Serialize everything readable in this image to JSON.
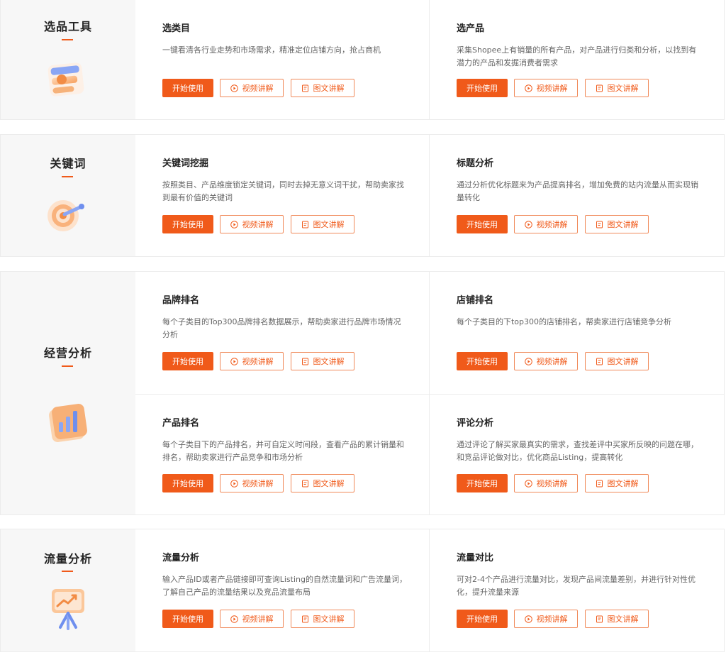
{
  "colors": {
    "accent": "#f05a1a",
    "panel": "#f7f7f7",
    "border": "#ececec"
  },
  "sections": [
    {
      "title": "选品工具",
      "icon": "product-selection-icon",
      "tools": [
        {
          "title": "选类目",
          "desc": "一键看清各行业走势和市场需求，精准定位店铺方向，抢占商机",
          "start": "开始使用",
          "video": "视频讲解",
          "doc": "图文讲解"
        },
        {
          "title": "选产品",
          "desc": "采集Shopee上有销量的所有产品，对产品进行归类和分析，以找到有潜力的产品和发掘消费者需求",
          "start": "开始使用",
          "video": "视频讲解",
          "doc": "图文讲解"
        }
      ]
    },
    {
      "title": "关键词",
      "icon": "keyword-target-icon",
      "tools": [
        {
          "title": "关键词挖掘",
          "desc": "按照类目、产品维度锁定关键词，同时去掉无意义词干扰，帮助卖家找到最有价值的关键词",
          "start": "开始使用",
          "video": "视频讲解",
          "doc": "图文讲解"
        },
        {
          "title": "标题分析",
          "desc": "通过分析优化标题来为产品提高排名，增加免费的站内流量从而实现销量转化",
          "start": "开始使用",
          "video": "视频讲解",
          "doc": "图文讲解"
        }
      ]
    },
    {
      "title": "经营分析",
      "icon": "bar-chart-icon",
      "tools": [
        {
          "title": "品牌排名",
          "desc": "每个子类目的Top300品牌排名数据展示，帮助卖家进行品牌市场情况分析",
          "start": "开始使用",
          "video": "视频讲解",
          "doc": "图文讲解"
        },
        {
          "title": "店铺排名",
          "desc": "每个子类目的下top300的店铺排名，帮卖家进行店铺竞争分析",
          "start": "开始使用",
          "video": "视频讲解",
          "doc": "图文讲解"
        },
        {
          "title": "产品排名",
          "desc": "每个子类目下的产品排名，并可自定义时间段，查看产品的累计销量和排名，帮助卖家进行产品竞争和市场分析",
          "start": "开始使用",
          "video": "视频讲解",
          "doc": "图文讲解"
        },
        {
          "title": "评论分析",
          "desc": "通过评论了解买家最真实的需求，查找差评中买家所反映的问题在哪，和竞品评论做对比，优化商品Listing，提高转化",
          "start": "开始使用",
          "video": "视频讲解",
          "doc": "图文讲解"
        }
      ]
    },
    {
      "title": "流量分析",
      "icon": "traffic-board-icon",
      "tools": [
        {
          "title": "流量分析",
          "desc": "输入产品ID或者产品链接即可查询Listing的自然流量词和广告流量词，了解自己产品的流量结果以及竞品流量布局",
          "start": "开始使用",
          "video": "视频讲解",
          "doc": "图文讲解"
        },
        {
          "title": "流量对比",
          "desc": "可对2-4个产品进行流量对比，发现产品间流量差别，并进行针对性优化，提升流量来源",
          "start": "开始使用",
          "video": "视频讲解",
          "doc": "图文讲解"
        }
      ]
    }
  ]
}
